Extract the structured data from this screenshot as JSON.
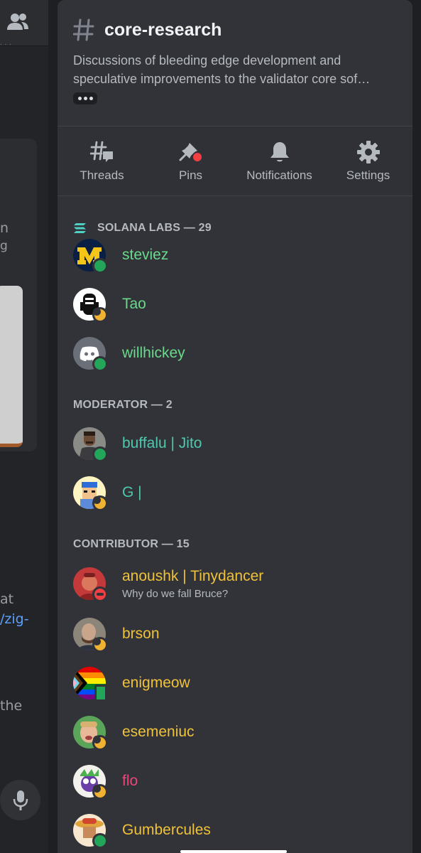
{
  "left_fragments": {
    "dots": "· · ·",
    "frag1": "n",
    "frag2": "g",
    "frag3": "at",
    "frag4": "/zig-",
    "frag5": "the"
  },
  "channel": {
    "name": "core-research",
    "topic": "Discussions of bleeding edge development and speculative improvements to the validator core sof…"
  },
  "actions": [
    {
      "label": "Threads",
      "icon": "threads-icon"
    },
    {
      "label": "Pins",
      "icon": "pin-icon"
    },
    {
      "label": "Notifications",
      "icon": "bell-icon"
    },
    {
      "label": "Settings",
      "icon": "gear-icon"
    }
  ],
  "sections": [
    {
      "title": "SOLANA LABS — 29",
      "color": "#57f287",
      "members": [
        {
          "name": "steviez",
          "status": "online",
          "color": "#6ad98b"
        },
        {
          "name": "Tao",
          "status": "idle",
          "color": "#6ad98b"
        },
        {
          "name": "willhickey",
          "status": "online",
          "color": "#6ad98b"
        }
      ]
    },
    {
      "title": "MODERATOR — 2",
      "members": [
        {
          "name": "buffalu | Jito",
          "status": "online",
          "color": "#4fc8ae"
        },
        {
          "name": "G |",
          "status": "idle",
          "color": "#4fc8ae"
        }
      ]
    },
    {
      "title": "CONTRIBUTOR — 15",
      "members": [
        {
          "name": "anoushk | Tinydancer",
          "sub": "Why do we fall Bruce?",
          "status": "dnd",
          "color": "#f0c23a"
        },
        {
          "name": "brson",
          "status": "idle",
          "color": "#f0c23a"
        },
        {
          "name": "enigmeow",
          "status": "mobile",
          "color": "#f0c23a"
        },
        {
          "name": "esemeniuc",
          "status": "idle",
          "color": "#f0c23a"
        },
        {
          "name": "flo",
          "status": "idle",
          "color": "#e8497a"
        },
        {
          "name": "Gumbercules",
          "status": "online",
          "color": "#f0c23a"
        }
      ]
    }
  ]
}
